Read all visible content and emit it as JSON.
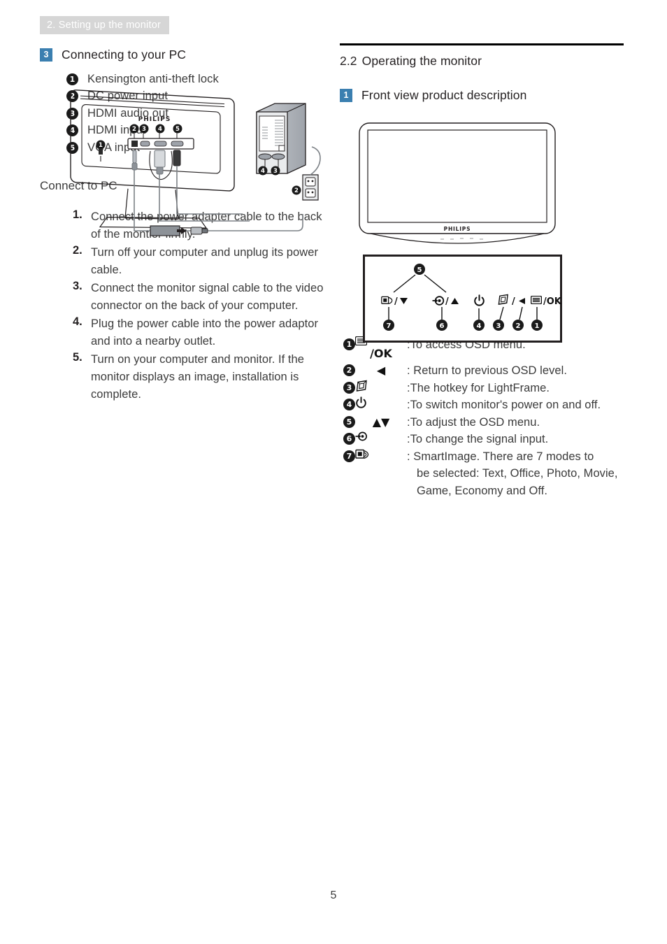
{
  "header": {
    "running_head": "2. Setting up the monitor"
  },
  "page": {
    "number": "5"
  },
  "left": {
    "section": {
      "badge": "3",
      "title": "Connecting to your PC"
    },
    "figure_rear": {
      "brand": "PHILIPS",
      "callouts": [
        "1",
        "2",
        "3",
        "4",
        "5"
      ],
      "pc_callouts": [
        "4",
        "3",
        "2"
      ]
    },
    "connector_list": [
      {
        "n": "1",
        "label": "Kensington anti-theft lock"
      },
      {
        "n": "2",
        "label": "DC power input"
      },
      {
        "n": "3",
        "label": "HDMI audio out"
      },
      {
        "n": "4",
        "label": "HDMI input"
      },
      {
        "n": "5",
        "label": "VGA input"
      }
    ],
    "connect_title": "Connect to PC",
    "steps": [
      {
        "n": "1.",
        "text": "Connect the power adapter cable to the back of the montior firmly."
      },
      {
        "n": "2.",
        "text": "Turn off your computer and unplug its power cable."
      },
      {
        "n": "3.",
        "text": "Connect the monitor signal cable to the video connector on the back of your computer."
      },
      {
        "n": "4.",
        "text": "Plug the power cable into the power adaptor and into a nearby outlet."
      },
      {
        "n": "5.",
        "text": "Turn on your computer and monitor. If the monitor displays an image, installation is complete."
      }
    ]
  },
  "right": {
    "chapter": {
      "number": "2.2",
      "title": "Operating the monitor"
    },
    "section": {
      "badge": "1",
      "title": "Front view product description"
    },
    "figure_front": {
      "brand": "PHILIPS"
    },
    "control_panel": {
      "top_callout": "5",
      "buttons": [
        {
          "callout": "7",
          "glyph": "smartimage/down"
        },
        {
          "callout": "6",
          "glyph": "input/up"
        },
        {
          "callout": "4",
          "glyph": "power"
        },
        {
          "callout": "3",
          "glyph": "lightframe"
        },
        {
          "callout": "2",
          "glyph": "left"
        },
        {
          "callout": "1",
          "glyph": "menu/OK"
        }
      ]
    },
    "control_list": [
      {
        "n": "1",
        "glyph": "/OK",
        "glyph_icon": "menu-icon",
        "desc": ":To access OSD menu.",
        "desc2": ""
      },
      {
        "n": "2",
        "glyph": "◀",
        "glyph_icon": "left-arrow-icon",
        "desc": ": Return to previous OSD level.",
        "desc2": ""
      },
      {
        "n": "3",
        "glyph": "",
        "glyph_icon": "lightframe-icon",
        "desc": ":The hotkey for LightFrame.",
        "desc2": ""
      },
      {
        "n": "4",
        "glyph": "",
        "glyph_icon": "power-icon",
        "desc": ":To switch monitor's power on and off.",
        "desc2": ""
      },
      {
        "n": "5",
        "glyph": "▲▼",
        "glyph_icon": "up-down-arrow-icon",
        "desc": ":To adjust the OSD menu.",
        "desc2": ""
      },
      {
        "n": "6",
        "glyph": "",
        "glyph_icon": "input-source-icon",
        "desc": ":To change the signal input.",
        "desc2": ""
      },
      {
        "n": "7",
        "glyph": "",
        "glyph_icon": "smartimage-icon",
        "desc": ": SmartImage. There are 7 modes to",
        "desc2": "be selected: Text, Office, Photo, Movie, Game, Economy and Off."
      }
    ]
  },
  "colors": {
    "badge_blue": "#3b7fb0",
    "header_gray": "#d6d6d6",
    "body_text": "#3b3b3b"
  }
}
